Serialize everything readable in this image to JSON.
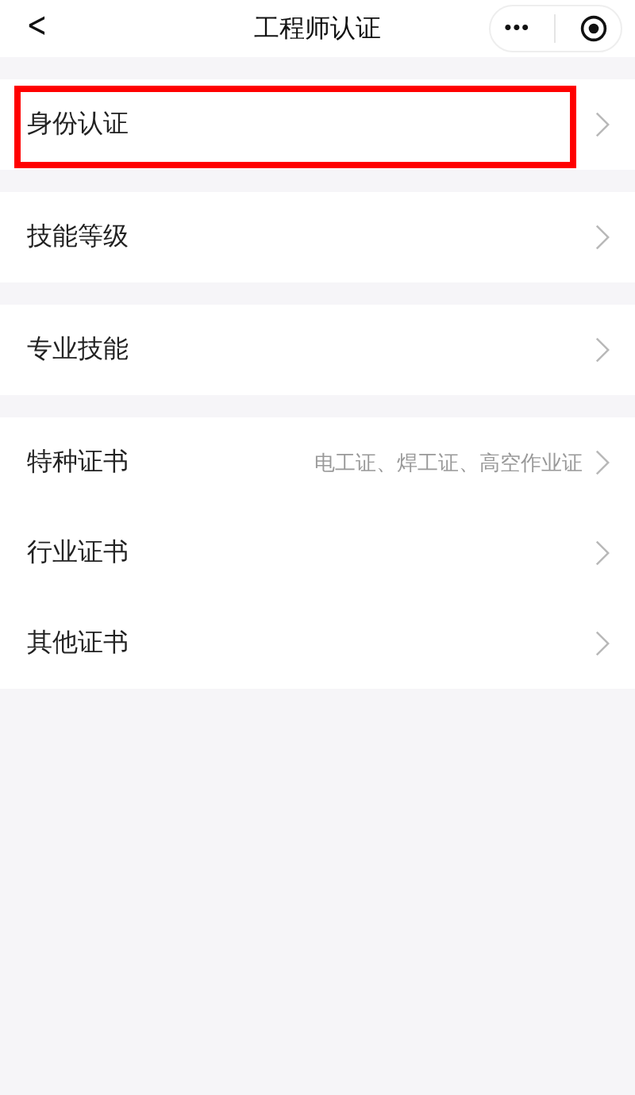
{
  "nav_bar": {
    "back": "<",
    "title": "工程师认证",
    "more": "•••"
  },
  "groups": [
    {
      "items": [
        {
          "label": "身份认证",
          "highlighted": true
        }
      ]
    },
    {
      "items": [
        {
          "label": "技能等级",
          "highlighted": false
        }
      ]
    },
    {
      "items": [
        {
          "label": "专业技能",
          "highlighted": false
        }
      ]
    },
    {
      "items": [
        {
          "label": "特种证书",
          "value": "电工证、焊工证、高空作业证",
          "highlighted": false
        },
        {
          "label": "行业证书",
          "highlighted": false
        },
        {
          "label": "其他证书",
          "highlighted": false
        }
      ]
    }
  ]
}
